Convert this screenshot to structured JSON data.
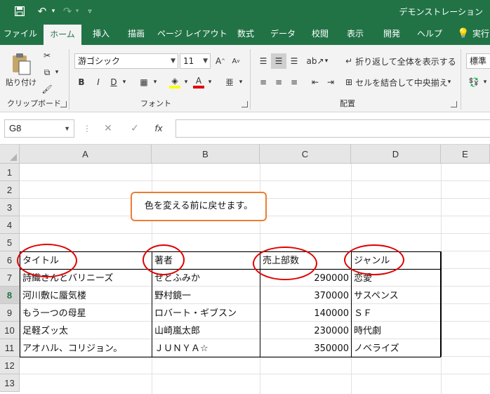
{
  "titlebar": {
    "doc_title": "デモンストレーション"
  },
  "tabs": [
    "ファイル",
    "ホーム",
    "挿入",
    "描画",
    "ページ レイアウト",
    "数式",
    "データ",
    "校閲",
    "表示",
    "開発",
    "ヘルプ",
    "実行"
  ],
  "ribbon": {
    "clipboard": {
      "paste_label": "貼り付け",
      "group_label": "クリップボード"
    },
    "font": {
      "font_name": "游ゴシック",
      "font_size": "11",
      "group_label": "フォント",
      "bold": "B",
      "italic": "I",
      "underline": "D"
    },
    "alignment": {
      "wrap_label": "折り返して全体を表示する",
      "merge_label": "セルを結合して中央揃え",
      "group_label": "配置"
    },
    "number": {
      "format": "標準"
    }
  },
  "formula_bar": {
    "name_box": "G8",
    "fx": "fx",
    "value": ""
  },
  "sheet": {
    "columns": [
      "A",
      "B",
      "C",
      "D",
      "E"
    ],
    "rows": [
      "1",
      "2",
      "3",
      "4",
      "5",
      "6",
      "7",
      "8",
      "9",
      "10",
      "11",
      "12",
      "13"
    ],
    "selected_row": "8",
    "note": "色を変える前に戻せます。",
    "header": [
      "タイトル",
      "著者",
      "売上部数",
      "ジャンル"
    ],
    "data": [
      [
        "詩織さんとバリニーズ",
        "せとふみか",
        "290000",
        "恋愛"
      ],
      [
        "河川敷に蜃気楼",
        "野村鏡一",
        "370000",
        "サスペンス"
      ],
      [
        "もう一つの母星",
        "ロバート・ギブスン",
        "140000",
        "ＳＦ"
      ],
      [
        "足軽ズッ太",
        "山崎嵐太郎",
        "230000",
        "時代劇"
      ],
      [
        "アオハル、コリジョン。",
        "ＪＵＮＹＡ☆",
        "350000",
        "ノベライズ"
      ]
    ]
  },
  "colors": {
    "accent": "#217346",
    "note_border": "#ed7d31",
    "circle": "#e00000"
  }
}
